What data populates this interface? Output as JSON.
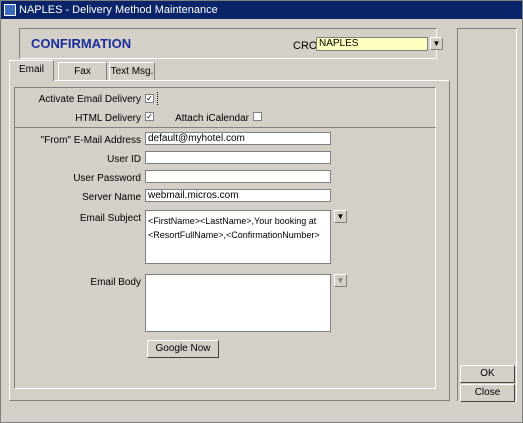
{
  "window": {
    "title": "NAPLES - Delivery Method Maintenance"
  },
  "header": {
    "title": "CONFIRMATION",
    "cro_label": "CRO",
    "cro_value": "NAPLES"
  },
  "tabs": [
    {
      "label": "Email"
    },
    {
      "label": "Fax"
    },
    {
      "label": "Text Msg."
    }
  ],
  "options": {
    "activate_label": "Activate Email Delivery",
    "activate_mark": "✓",
    "html_label": "HTML Delivery",
    "html_mark": "✓",
    "icalendar_label": "Attach iCalendar"
  },
  "form": {
    "from_label": "\"From\" E-Mail Address",
    "from_value": "default@myhotel.com",
    "userid_label": "User ID",
    "userid_value": "",
    "password_label": "User Password",
    "password_value": "",
    "server_label": "Server Name",
    "server_value": "webmail.micros.com",
    "subject_label": "Email Subject",
    "subject_line1": "<FirstName><LastName>,Your booking  at",
    "subject_line2": "<ResortFullName>,<ConfirmationNumber>",
    "body_label": "Email Body",
    "body_value": "",
    "google_button": "Google Now"
  },
  "actions": {
    "ok": "OK",
    "close": "Close"
  }
}
